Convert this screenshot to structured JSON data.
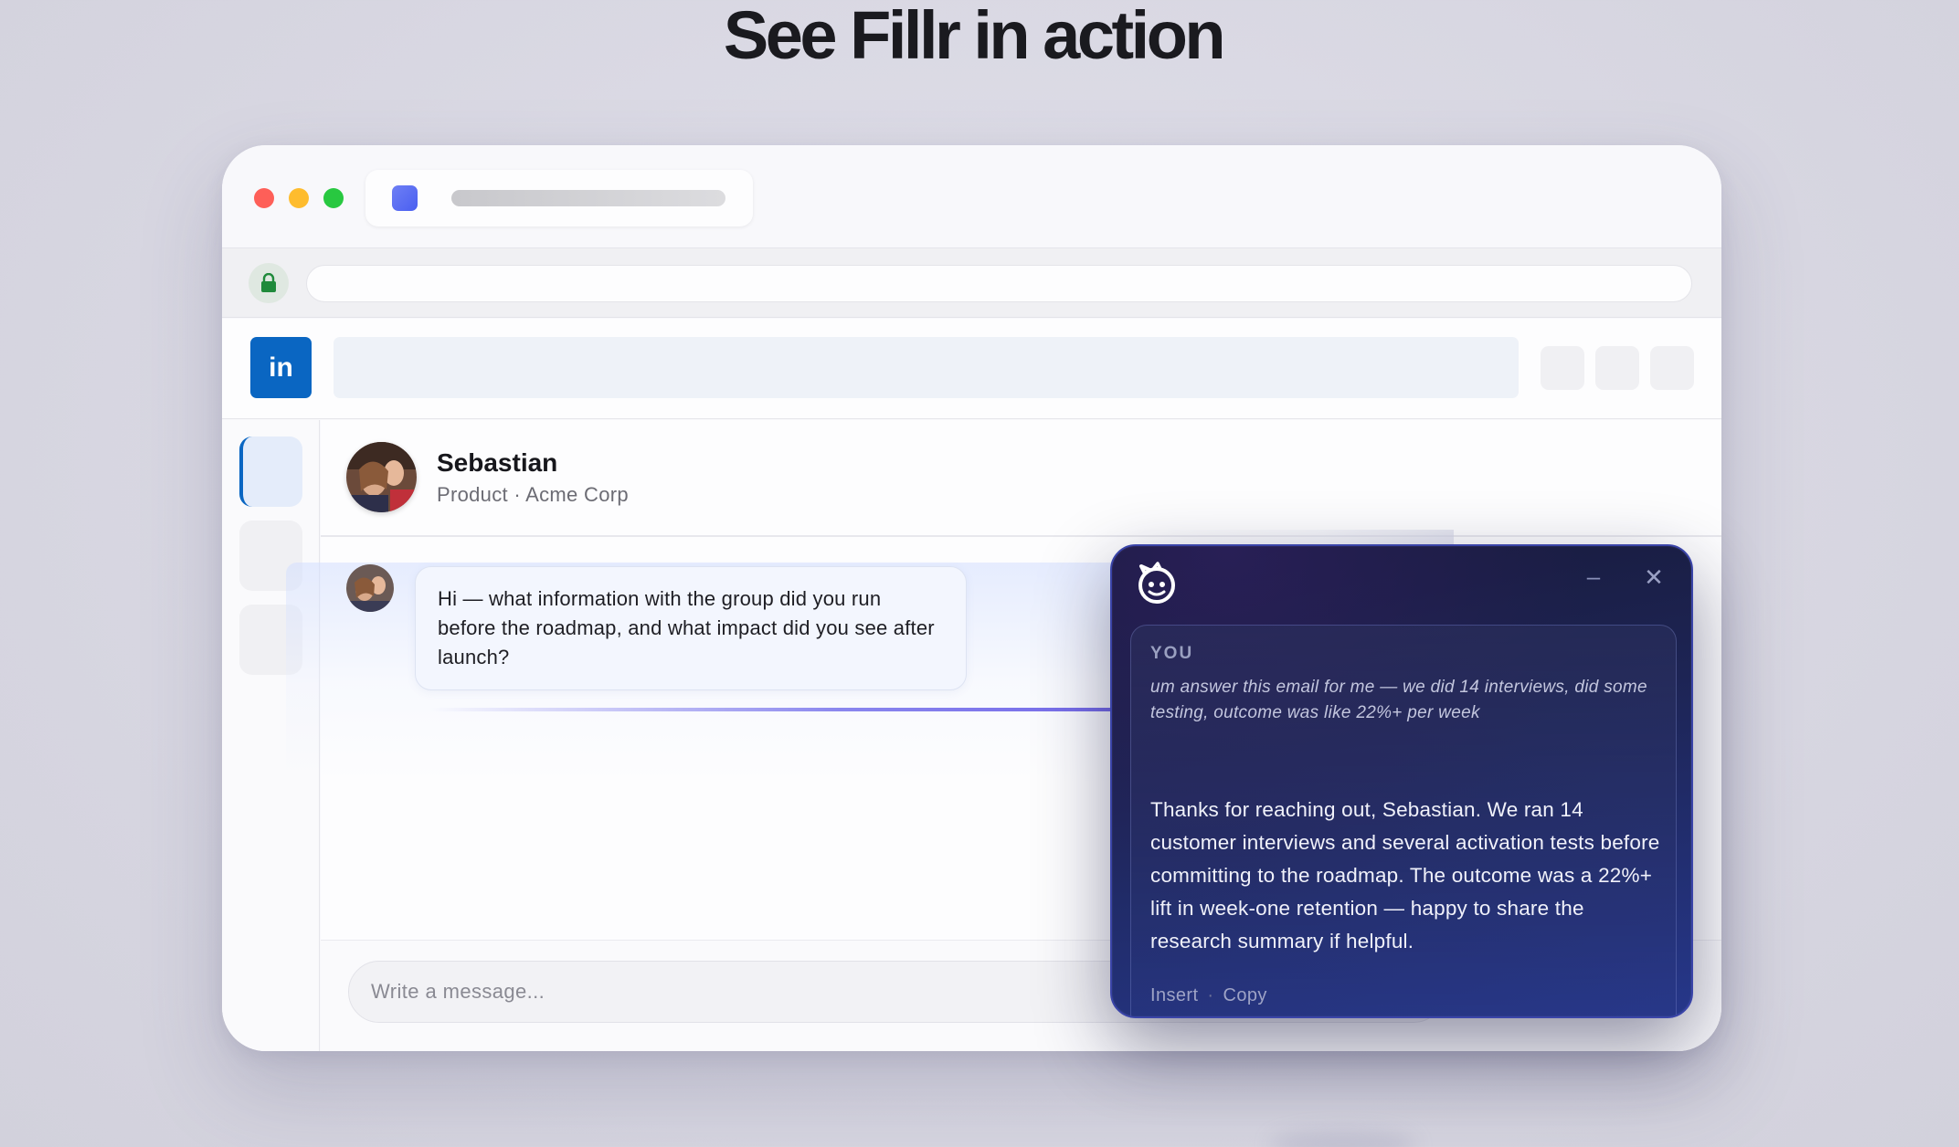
{
  "headline": "See Fillr in action",
  "browser": {
    "tab_favicon": "app-square-icon",
    "lock_icon": "lock-icon"
  },
  "app": {
    "logo_text": "in",
    "brand_color": "#0a66c2"
  },
  "contact": {
    "name": "Sebastian",
    "subtitle": "Product · Acme Corp"
  },
  "message": {
    "text": "Hi — what information with the group did you run before the roadmap, and what impact did you see after launch?"
  },
  "composer": {
    "placeholder": "Write a message..."
  },
  "assistant": {
    "min_glyph": "–",
    "close_glyph": "✕",
    "you_label": "YOU",
    "prompt": "um answer this email for me — we did 14 interviews, did some testing, outcome was like 22%+ per week",
    "response": "Thanks for reaching out, Sebastian. We ran 14 customer interviews and several activation tests before committing to the roadmap. The outcome was a 22%+ lift in week-one retention — happy to share the research summary if helpful.",
    "actions": {
      "insert": "Insert",
      "separator": "·",
      "copy": "Copy"
    }
  }
}
